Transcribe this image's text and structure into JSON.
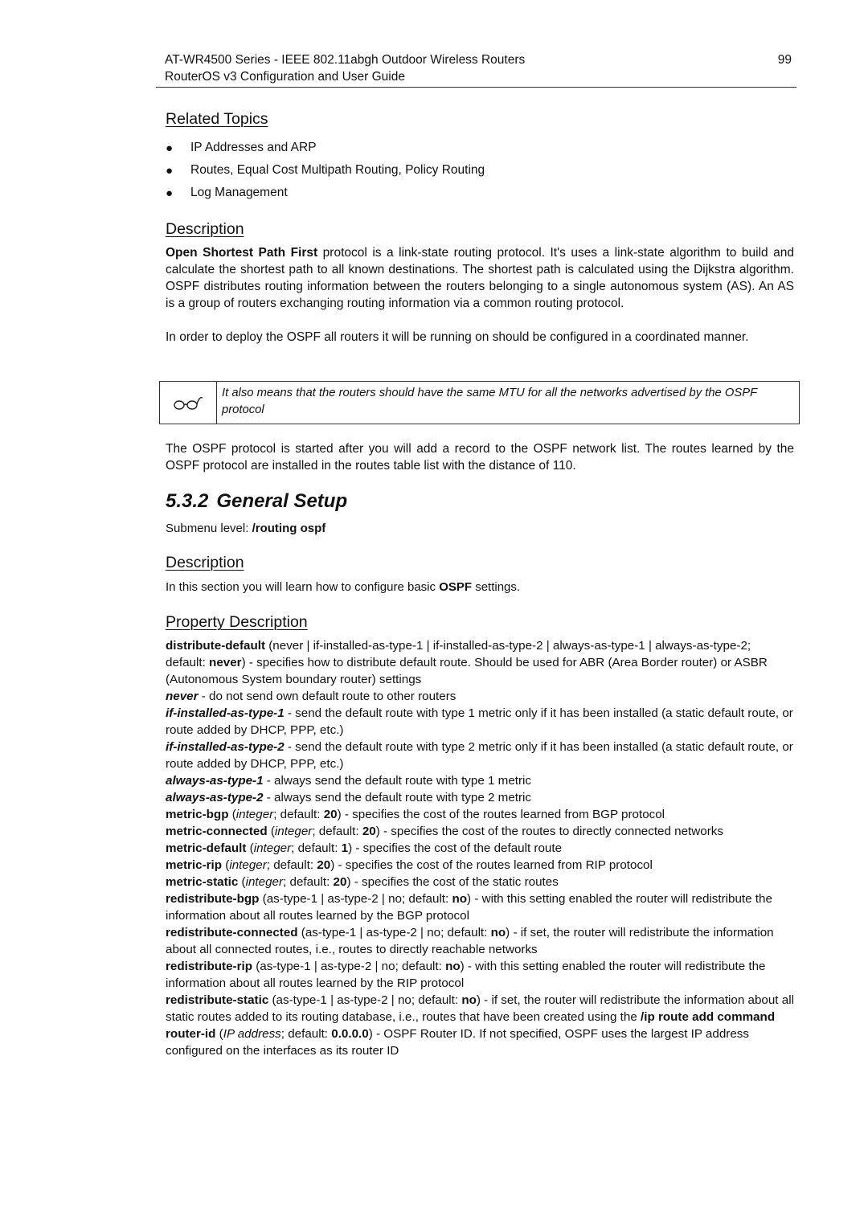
{
  "header": {
    "title": "AT-WR4500 Series - IEEE 802.11abgh Outdoor Wireless Routers",
    "subtitle": "RouterOS v3 Configuration and User Guide",
    "page_number": "99"
  },
  "related_topics": {
    "heading": "Related Topics",
    "items": [
      "IP Addresses and ARP",
      "Routes, Equal Cost Multipath Routing, Policy Routing",
      "Log Management"
    ]
  },
  "description1": {
    "heading": "Description",
    "p1_bold": "Open Shortest Path First",
    "p1_rest": " protocol is a link-state routing protocol. It's uses a link-state algorithm to build and calculate the shortest path to all known destinations. The shortest path is calculated using the Dijkstra algorithm. OSPF distributes routing information between the routers belonging to a single autonomous system (AS). An AS is a group of routers exchanging routing information via a common routing protocol.",
    "p2": "In order to deploy the OSPF all routers it will be running on should be configured in a coordinated manner."
  },
  "note": {
    "icon": "glasses-icon",
    "text": "It also means that the routers should have the same MTU for all the networks advertised by the OSPF protocol"
  },
  "paragraph_after_note": "The OSPF protocol is started after you will add a record to the OSPF network list. The routes learned by the OSPF protocol are installed in the routes table list with the distance of 110.",
  "section": {
    "number": "5.3.2",
    "title": "General Setup",
    "submenu_label": "Submenu level: ",
    "submenu_path": "/routing ospf"
  },
  "description2": {
    "heading": "Description",
    "text_before": "In this section you will learn how to configure basic ",
    "text_bold": "OSPF",
    "text_after": " settings."
  },
  "property_description": {
    "heading": "Property Description",
    "distribute_default": {
      "name": "distribute-default",
      "spec_pre": " (never | if-installed-as-type-1 | if-installed-as-type-2 | always-as-type-1 | always-as-type-2; default: ",
      "default": "never",
      "desc": ") - specifies how to distribute default route. Should be used for ABR (Area Border router) or ASBR (Autonomous System boundary router) settings"
    },
    "values": [
      {
        "name": "never",
        "desc": " - do not send own default route to other routers"
      },
      {
        "name": "if-installed-as-type-1",
        "desc": " - send the default route with type 1 metric only if it has been installed (a static default route, or route added by DHCP, PPP, etc.)"
      },
      {
        "name": "if-installed-as-type-2",
        "desc": " - send the default route with type 2 metric only if it has been installed (a static default route, or route added by DHCP, PPP, etc.)"
      },
      {
        "name": "always-as-type-1",
        "desc": " - always send the default route with type 1 metric"
      },
      {
        "name": "always-as-type-2",
        "desc": " - always send the default route with type 2 metric"
      }
    ],
    "integer_props": [
      {
        "name": "metric-bgp",
        "type": "integer",
        "default": "20",
        "desc": ") - specifies the cost of the routes learned from BGP protocol"
      },
      {
        "name": "metric-connected",
        "type": "integer",
        "default": "20",
        "desc": ") - specifies the cost of the routes to directly connected networks"
      },
      {
        "name": "metric-default",
        "type": "integer",
        "default": "1",
        "desc": ") - specifies the cost of the default route"
      },
      {
        "name": "metric-rip",
        "type": "integer",
        "default": "20",
        "desc": ") - specifies the cost of the routes learned from RIP protocol"
      },
      {
        "name": "metric-static",
        "type": "integer",
        "default": "20",
        "desc": ") - specifies the cost of the static routes"
      }
    ],
    "redistribute_props": [
      {
        "name": "redistribute-bgp",
        "spec": " (as-type-1 | as-type-2 | no; default: ",
        "default": "no",
        "desc": ") - with this setting enabled the router will redistribute the information about all routes learned by the BGP protocol"
      },
      {
        "name": "redistribute-connected",
        "spec": " (as-type-1 | as-type-2 | no; default: ",
        "default": "no",
        "desc": ") - if set, the router will redistribute the information about all connected routes, i.e., routes to directly reachable networks"
      },
      {
        "name": "redistribute-rip",
        "spec": " (as-type-1 | as-type-2 | no; default: ",
        "default": "no",
        "desc": ") - with this setting enabled the router will redistribute the information about all routes learned by the RIP protocol"
      },
      {
        "name": "redistribute-static",
        "spec": " (as-type-1 | as-type-2 | no; default: ",
        "default": "no",
        "desc": ") - if set, the router will redistribute the information about all static routes added to its routing database, i.e., routes that have been created using the ",
        "command": "/ip route add command"
      }
    ],
    "router_id": {
      "name": "router-id",
      "type": "IP address",
      "default": "0.0.0.0",
      "desc": ") - OSPF Router ID. If not specified, OSPF uses the largest IP address configured on the interfaces as its router ID"
    }
  }
}
